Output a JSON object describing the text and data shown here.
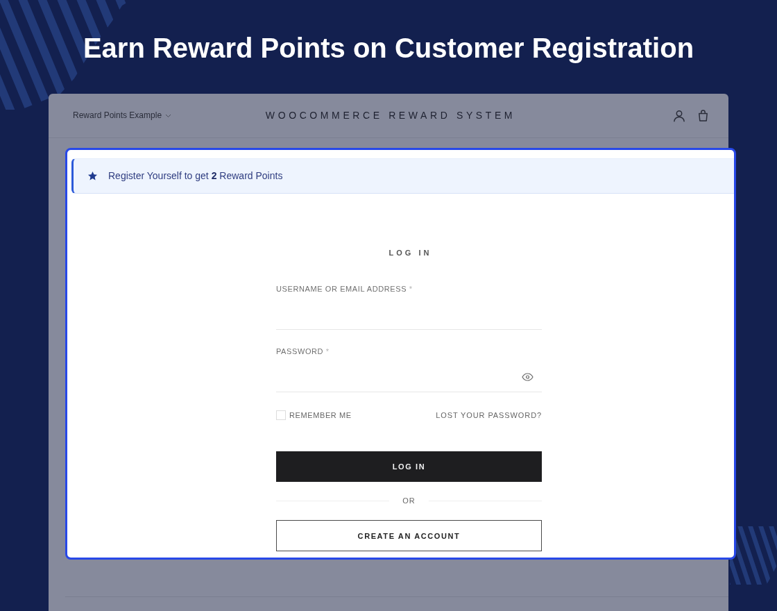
{
  "title": "Earn Reward Points on Customer Registration",
  "site_header": {
    "site_name": "Reward Points Example",
    "brand": "WOOCOMMERCE REWARD SYSTEM"
  },
  "notice": {
    "text": "Register Yourself to get **2** Reward Points"
  },
  "login_form": {
    "heading": "LOG IN",
    "fields": [
      {
        "kind": "text",
        "label": "USERNAME OR EMAIL ADDRESS",
        "required_mark": "*"
      },
      {
        "kind": "password",
        "label": "PASSWORD",
        "required_mark": "*"
      }
    ],
    "remember": {
      "label": "REMEMBER ME",
      "checked": false
    },
    "lost_password_link": "LOST YOUR PASSWORD?",
    "login_button": "LOG IN",
    "divider": "OR",
    "create_account_button": "CREATE AN ACCOUNT"
  }
}
